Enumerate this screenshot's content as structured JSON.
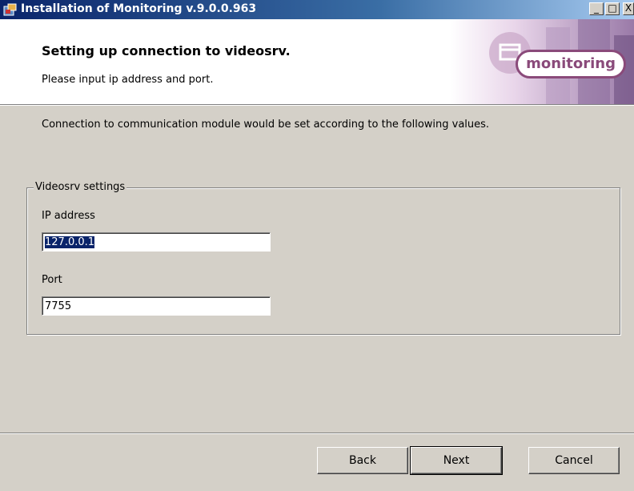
{
  "window": {
    "title": "Installation of Monitoring v.9.0.0.963",
    "controls": {
      "minimize": "_",
      "maximize": "□",
      "close": "X"
    }
  },
  "header": {
    "title": "Setting up connection to videosrv.",
    "subtitle": "Please input ip address and port.",
    "logo_text": "monitoring",
    "logo_color": "#8a4a7a"
  },
  "description": "Connection to communication module would be set according to the following values.",
  "videosrv_group": {
    "legend": "Videosrv settings",
    "ip_label": "IP address",
    "ip_value": "127.0.0.1",
    "port_label": "Port",
    "port_value": "7755"
  },
  "buttons": {
    "back": "Back",
    "next": "Next",
    "cancel": "Cancel"
  }
}
